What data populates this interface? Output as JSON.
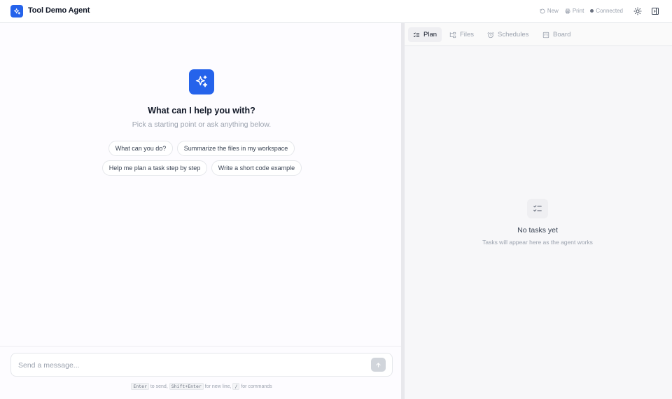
{
  "header": {
    "title": "Tool Demo Agent",
    "new_label": "New",
    "print_label": "Print",
    "status_label": "Connected"
  },
  "chat": {
    "hero_title": "What can I help you with?",
    "hero_subtitle": "Pick a starting point or ask anything below.",
    "suggestions": [
      "What can you do?",
      "Summarize the files in my workspace",
      "Help me plan a task step by step",
      "Write a short code example"
    ],
    "composer_placeholder": "Send a message...",
    "hint": {
      "key_send": "Enter",
      "text_send": "to send,",
      "key_newline": "Shift+Enter",
      "text_newline": "for new line,",
      "key_commands": "/",
      "text_commands": "for commands"
    }
  },
  "panel": {
    "tabs": [
      "Plan",
      "Files",
      "Schedules",
      "Board"
    ],
    "active_tab": "Plan",
    "empty_title": "No tasks yet",
    "empty_subtitle": "Tasks will appear here as the agent works"
  },
  "icons": {
    "logo": "sparkles-icon",
    "new": "refresh-icon",
    "print": "printer-icon",
    "status": "status-dot-icon",
    "theme": "sun-icon",
    "panel_toggle": "panel-right-icon",
    "send": "arrow-up-icon",
    "plan": "list-checks-icon",
    "files": "folder-tree-icon",
    "schedules": "alarm-clock-icon",
    "board": "kanban-icon"
  },
  "colors": {
    "accent": "#2563eb",
    "text": "#111827",
    "muted": "#9ca3af",
    "border": "#e5e7eb"
  }
}
